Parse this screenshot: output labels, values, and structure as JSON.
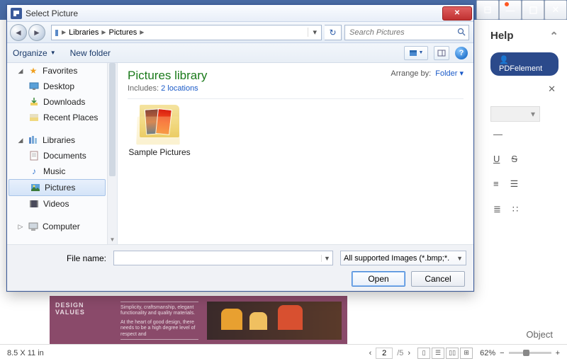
{
  "bg": {
    "help": "Help",
    "pdfe": "PDFelement",
    "underline": "U",
    "strike": "S",
    "object": "Object"
  },
  "status": {
    "size": "8.5 X 11 in",
    "page": "2",
    "pages": "/5",
    "zoom": "62%"
  },
  "doc": {
    "heading": "DESIGN VALUES",
    "line1": "Simplicity, craftsmanship, elegant functionality and quality materials.",
    "line2": "At the heart of good design, there needs to be a high degree level of respect and"
  },
  "dialog": {
    "title": "Select Picture",
    "breadcrumb": {
      "libraries": "Libraries",
      "pictures": "Pictures"
    },
    "search_placeholder": "Search Pictures",
    "organize": "Organize",
    "new_folder": "New folder",
    "library_title": "Pictures library",
    "includes": "Includes:",
    "locations": "2 locations",
    "arrange_by": "Arrange by:",
    "arrange_value": "Folder",
    "folder_name": "Sample Pictures",
    "filename_label": "File name:",
    "filetype": "All supported Images (*.bmp;*.",
    "open": "Open",
    "cancel": "Cancel"
  },
  "tree": {
    "favorites": "Favorites",
    "desktop": "Desktop",
    "downloads": "Downloads",
    "recent": "Recent Places",
    "libraries": "Libraries",
    "documents": "Documents",
    "music": "Music",
    "pictures": "Pictures",
    "videos": "Videos",
    "computer": "Computer"
  }
}
